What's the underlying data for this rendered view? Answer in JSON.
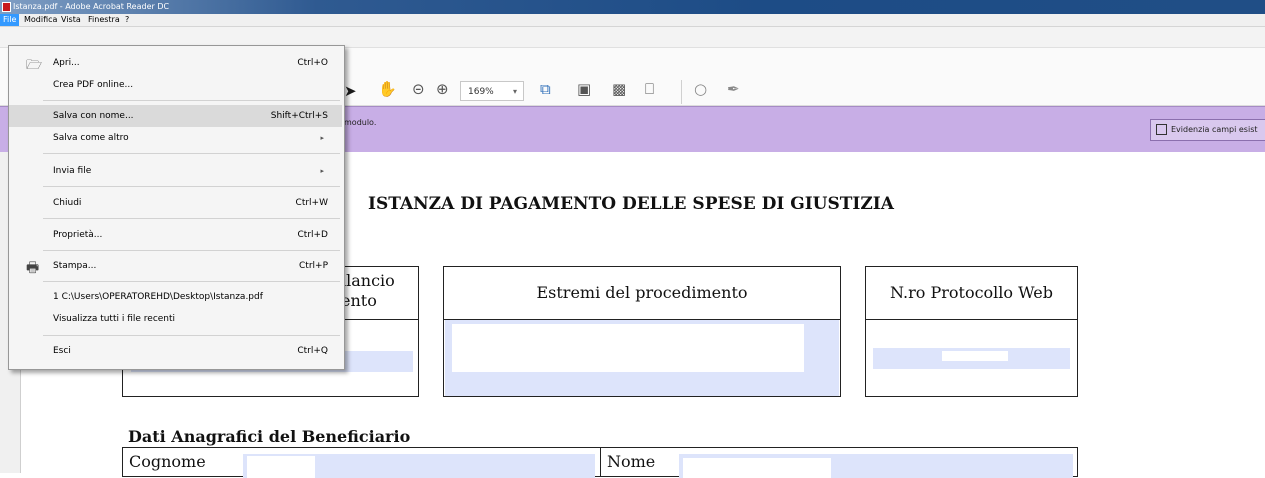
{
  "window": {
    "title": "Istanza.pdf - Adobe Acrobat Reader DC"
  },
  "menubar": {
    "items": [
      "File",
      "Modifica",
      "Vista",
      "Finestra",
      "?"
    ]
  },
  "toolbar": {
    "zoom": "169%"
  },
  "formbar": {
    "message": "modulo.",
    "highlight_button": "Evidenzia campi esist"
  },
  "file_menu": {
    "open": {
      "label": "Apri...",
      "shortcut": "Ctrl+O"
    },
    "create_pdf": {
      "label": "Crea PDF online..."
    },
    "save_as": {
      "label": "Salva con nome...",
      "shortcut": "Shift+Ctrl+S"
    },
    "save_other": {
      "label": "Salva come altro"
    },
    "send": {
      "label": "Invia file"
    },
    "close": {
      "label": "Chiudi",
      "shortcut": "Ctrl+W"
    },
    "properties": {
      "label": "Proprietà...",
      "shortcut": "Ctrl+D"
    },
    "print": {
      "label": "Stampa...",
      "shortcut": "Ctrl+P"
    },
    "recent1": {
      "label": "1 C:\\Users\\OPERATOREHD\\Desktop\\Istanza.pdf"
    },
    "recent_all": {
      "label": "Visualizza tutti i file recenti"
    },
    "exit": {
      "label": "Esci",
      "shortcut": "Ctrl+Q"
    }
  },
  "document": {
    "title": "ISTANZA DI PAGAMENTO DELLE SPESE DI GIUSTIZIA",
    "box1_head_line1": "ilancio",
    "box1_head_line2": "ento",
    "box2_head": "Estremi del procedimento",
    "box3_head": "N.ro Protocollo Web",
    "section_beneficiary": "Dati Anagrafici del Beneficiario",
    "surname_label": "Cognome",
    "name_label": "Nome"
  }
}
